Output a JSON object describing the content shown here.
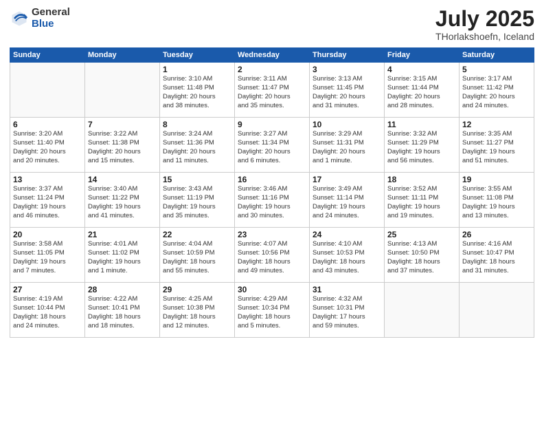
{
  "header": {
    "logo_general": "General",
    "logo_blue": "Blue",
    "month_title": "July 2025",
    "location": "THorlakshoefn, Iceland"
  },
  "calendar": {
    "days_of_week": [
      "Sunday",
      "Monday",
      "Tuesday",
      "Wednesday",
      "Thursday",
      "Friday",
      "Saturday"
    ],
    "weeks": [
      [
        {
          "day": "",
          "info": ""
        },
        {
          "day": "",
          "info": ""
        },
        {
          "day": "1",
          "info": "Sunrise: 3:10 AM\nSunset: 11:48 PM\nDaylight: 20 hours\nand 38 minutes."
        },
        {
          "day": "2",
          "info": "Sunrise: 3:11 AM\nSunset: 11:47 PM\nDaylight: 20 hours\nand 35 minutes."
        },
        {
          "day": "3",
          "info": "Sunrise: 3:13 AM\nSunset: 11:45 PM\nDaylight: 20 hours\nand 31 minutes."
        },
        {
          "day": "4",
          "info": "Sunrise: 3:15 AM\nSunset: 11:44 PM\nDaylight: 20 hours\nand 28 minutes."
        },
        {
          "day": "5",
          "info": "Sunrise: 3:17 AM\nSunset: 11:42 PM\nDaylight: 20 hours\nand 24 minutes."
        }
      ],
      [
        {
          "day": "6",
          "info": "Sunrise: 3:20 AM\nSunset: 11:40 PM\nDaylight: 20 hours\nand 20 minutes."
        },
        {
          "day": "7",
          "info": "Sunrise: 3:22 AM\nSunset: 11:38 PM\nDaylight: 20 hours\nand 15 minutes."
        },
        {
          "day": "8",
          "info": "Sunrise: 3:24 AM\nSunset: 11:36 PM\nDaylight: 20 hours\nand 11 minutes."
        },
        {
          "day": "9",
          "info": "Sunrise: 3:27 AM\nSunset: 11:34 PM\nDaylight: 20 hours\nand 6 minutes."
        },
        {
          "day": "10",
          "info": "Sunrise: 3:29 AM\nSunset: 11:31 PM\nDaylight: 20 hours\nand 1 minute."
        },
        {
          "day": "11",
          "info": "Sunrise: 3:32 AM\nSunset: 11:29 PM\nDaylight: 19 hours\nand 56 minutes."
        },
        {
          "day": "12",
          "info": "Sunrise: 3:35 AM\nSunset: 11:27 PM\nDaylight: 19 hours\nand 51 minutes."
        }
      ],
      [
        {
          "day": "13",
          "info": "Sunrise: 3:37 AM\nSunset: 11:24 PM\nDaylight: 19 hours\nand 46 minutes."
        },
        {
          "day": "14",
          "info": "Sunrise: 3:40 AM\nSunset: 11:22 PM\nDaylight: 19 hours\nand 41 minutes."
        },
        {
          "day": "15",
          "info": "Sunrise: 3:43 AM\nSunset: 11:19 PM\nDaylight: 19 hours\nand 35 minutes."
        },
        {
          "day": "16",
          "info": "Sunrise: 3:46 AM\nSunset: 11:16 PM\nDaylight: 19 hours\nand 30 minutes."
        },
        {
          "day": "17",
          "info": "Sunrise: 3:49 AM\nSunset: 11:14 PM\nDaylight: 19 hours\nand 24 minutes."
        },
        {
          "day": "18",
          "info": "Sunrise: 3:52 AM\nSunset: 11:11 PM\nDaylight: 19 hours\nand 19 minutes."
        },
        {
          "day": "19",
          "info": "Sunrise: 3:55 AM\nSunset: 11:08 PM\nDaylight: 19 hours\nand 13 minutes."
        }
      ],
      [
        {
          "day": "20",
          "info": "Sunrise: 3:58 AM\nSunset: 11:05 PM\nDaylight: 19 hours\nand 7 minutes."
        },
        {
          "day": "21",
          "info": "Sunrise: 4:01 AM\nSunset: 11:02 PM\nDaylight: 19 hours\nand 1 minute."
        },
        {
          "day": "22",
          "info": "Sunrise: 4:04 AM\nSunset: 10:59 PM\nDaylight: 18 hours\nand 55 minutes."
        },
        {
          "day": "23",
          "info": "Sunrise: 4:07 AM\nSunset: 10:56 PM\nDaylight: 18 hours\nand 49 minutes."
        },
        {
          "day": "24",
          "info": "Sunrise: 4:10 AM\nSunset: 10:53 PM\nDaylight: 18 hours\nand 43 minutes."
        },
        {
          "day": "25",
          "info": "Sunrise: 4:13 AM\nSunset: 10:50 PM\nDaylight: 18 hours\nand 37 minutes."
        },
        {
          "day": "26",
          "info": "Sunrise: 4:16 AM\nSunset: 10:47 PM\nDaylight: 18 hours\nand 31 minutes."
        }
      ],
      [
        {
          "day": "27",
          "info": "Sunrise: 4:19 AM\nSunset: 10:44 PM\nDaylight: 18 hours\nand 24 minutes."
        },
        {
          "day": "28",
          "info": "Sunrise: 4:22 AM\nSunset: 10:41 PM\nDaylight: 18 hours\nand 18 minutes."
        },
        {
          "day": "29",
          "info": "Sunrise: 4:25 AM\nSunset: 10:38 PM\nDaylight: 18 hours\nand 12 minutes."
        },
        {
          "day": "30",
          "info": "Sunrise: 4:29 AM\nSunset: 10:34 PM\nDaylight: 18 hours\nand 5 minutes."
        },
        {
          "day": "31",
          "info": "Sunrise: 4:32 AM\nSunset: 10:31 PM\nDaylight: 17 hours\nand 59 minutes."
        },
        {
          "day": "",
          "info": ""
        },
        {
          "day": "",
          "info": ""
        }
      ]
    ]
  }
}
